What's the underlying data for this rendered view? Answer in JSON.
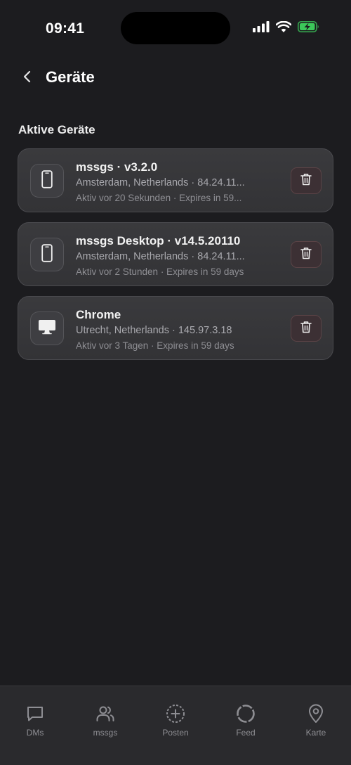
{
  "status_bar": {
    "time": "09:41"
  },
  "header": {
    "title": "Geräte"
  },
  "section": {
    "title": "Aktive Geräte"
  },
  "devices": [
    {
      "icon": "phone-icon",
      "name": "mssgs · v3.2.0",
      "location": "Amsterdam, Netherlands · 84.24.11...",
      "activity": "Aktiv vor 20 Sekunden · Expires in 59..."
    },
    {
      "icon": "phone-icon",
      "name": "mssgs Desktop · v14.5.20110",
      "location": "Amsterdam, Netherlands · 84.24.11...",
      "activity": "Aktiv vor 2 Stunden · Expires in 59 days"
    },
    {
      "icon": "desktop-icon",
      "name": "Chrome",
      "location": "Utrecht, Netherlands · 145.97.3.18",
      "activity": "Aktiv vor 3 Tagen · Expires in 59 days"
    }
  ],
  "tabs": [
    {
      "label": "DMs",
      "icon": "chat-bubble-icon"
    },
    {
      "label": "mssgs",
      "icon": "users-icon"
    },
    {
      "label": "Posten",
      "icon": "plus-circle-icon"
    },
    {
      "label": "Feed",
      "icon": "circle-icon"
    },
    {
      "label": "Karte",
      "icon": "map-pin-icon"
    }
  ],
  "colors": {
    "background": "#1c1c1f",
    "card": "#38383b",
    "delete_accent": "#5a4346",
    "tab_bar": "#2a2a2d",
    "muted_text": "#8e8e93"
  }
}
